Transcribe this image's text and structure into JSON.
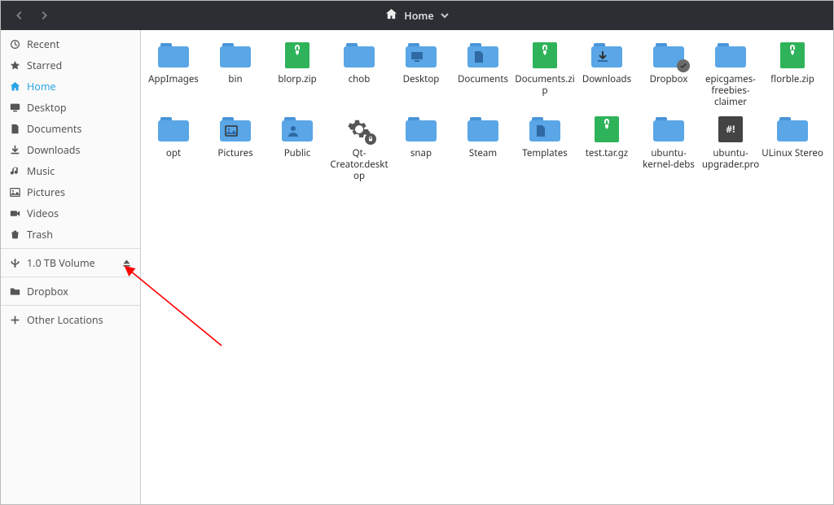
{
  "titlebar": {
    "location_label": "Home"
  },
  "sidebar": {
    "places": [
      {
        "id": "recent",
        "label": "Recent",
        "icon": "clock"
      },
      {
        "id": "starred",
        "label": "Starred",
        "icon": "star"
      },
      {
        "id": "home",
        "label": "Home",
        "icon": "home",
        "active": true
      },
      {
        "id": "desktop",
        "label": "Desktop",
        "icon": "monitor"
      },
      {
        "id": "documents",
        "label": "Documents",
        "icon": "doc"
      },
      {
        "id": "downloads",
        "label": "Downloads",
        "icon": "download"
      },
      {
        "id": "music",
        "label": "Music",
        "icon": "music"
      },
      {
        "id": "pictures",
        "label": "Pictures",
        "icon": "picture"
      },
      {
        "id": "videos",
        "label": "Videos",
        "icon": "video"
      },
      {
        "id": "trash",
        "label": "Trash",
        "icon": "trash"
      }
    ],
    "devices": [
      {
        "id": "vol-1tb",
        "label": "1.0 TB Volume",
        "icon": "usb",
        "ejectable": true
      }
    ],
    "bookmarks": [
      {
        "id": "dropbox-bm",
        "label": "Dropbox",
        "icon": "folder"
      }
    ],
    "other": [
      {
        "id": "other-loc",
        "label": "Other Locations",
        "icon": "plus"
      }
    ]
  },
  "files": [
    {
      "name": "AppImages",
      "type": "folder"
    },
    {
      "name": "bin",
      "type": "folder"
    },
    {
      "name": "blorp.zip",
      "type": "zip"
    },
    {
      "name": "chob",
      "type": "folder"
    },
    {
      "name": "Desktop",
      "type": "folder",
      "overlay": "monitor"
    },
    {
      "name": "Documents",
      "type": "folder",
      "overlay": "doc"
    },
    {
      "name": "Documents.zip",
      "type": "zip"
    },
    {
      "name": "Downloads",
      "type": "folder",
      "overlay": "download"
    },
    {
      "name": "Dropbox",
      "type": "folder",
      "sync": true
    },
    {
      "name": "epicgames-freebies-claimer",
      "type": "folder"
    },
    {
      "name": "florble.zip",
      "type": "zip"
    },
    {
      "name": "opt",
      "type": "folder"
    },
    {
      "name": "Pictures",
      "type": "folder",
      "overlay": "picture"
    },
    {
      "name": "Public",
      "type": "folder",
      "overlay": "public"
    },
    {
      "name": "Qt-Creator.desktop",
      "type": "exec"
    },
    {
      "name": "snap",
      "type": "folder"
    },
    {
      "name": "Steam",
      "type": "folder"
    },
    {
      "name": "Templates",
      "type": "folder",
      "overlay": "doc"
    },
    {
      "name": "test.tar.gz",
      "type": "zip"
    },
    {
      "name": "ubuntu-kernel-debs",
      "type": "folder"
    },
    {
      "name": "ubuntu-upgrader.pro",
      "type": "script"
    },
    {
      "name": "ULinux Stereo",
      "type": "folder"
    }
  ]
}
